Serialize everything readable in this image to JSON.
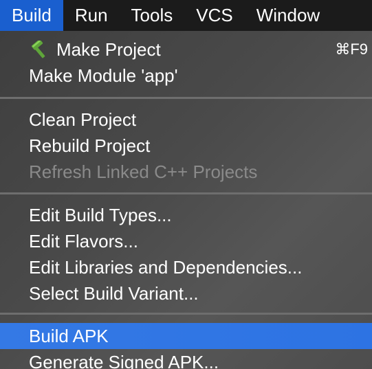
{
  "menubar": {
    "items": [
      {
        "label": "Build",
        "active": true
      },
      {
        "label": "Run"
      },
      {
        "label": "Tools"
      },
      {
        "label": "VCS"
      },
      {
        "label": "Window"
      }
    ]
  },
  "menu": {
    "make_project": {
      "label": "Make Project",
      "shortcut": "⌘F9",
      "icon": "hammer-icon"
    },
    "make_module": {
      "label": "Make Module 'app'"
    },
    "clean_project": {
      "label": "Clean Project"
    },
    "rebuild_project": {
      "label": "Rebuild Project"
    },
    "refresh_linked": {
      "label": "Refresh Linked C++ Projects",
      "enabled": false
    },
    "edit_build_types": {
      "label": "Edit Build Types..."
    },
    "edit_flavors": {
      "label": "Edit Flavors..."
    },
    "edit_libraries": {
      "label": "Edit Libraries and Dependencies..."
    },
    "select_build_variant": {
      "label": "Select Build Variant..."
    },
    "build_apk": {
      "label": "Build APK",
      "highlighted": true
    },
    "generate_signed_apk": {
      "label": "Generate Signed APK..."
    }
  },
  "colors": {
    "menubar_bg": "#1b1b1b",
    "active_menu": "#1a5fcf",
    "highlight": "#3479e5",
    "disabled_text": "#8a8a8a",
    "hammer_green": "#5fa53a"
  }
}
